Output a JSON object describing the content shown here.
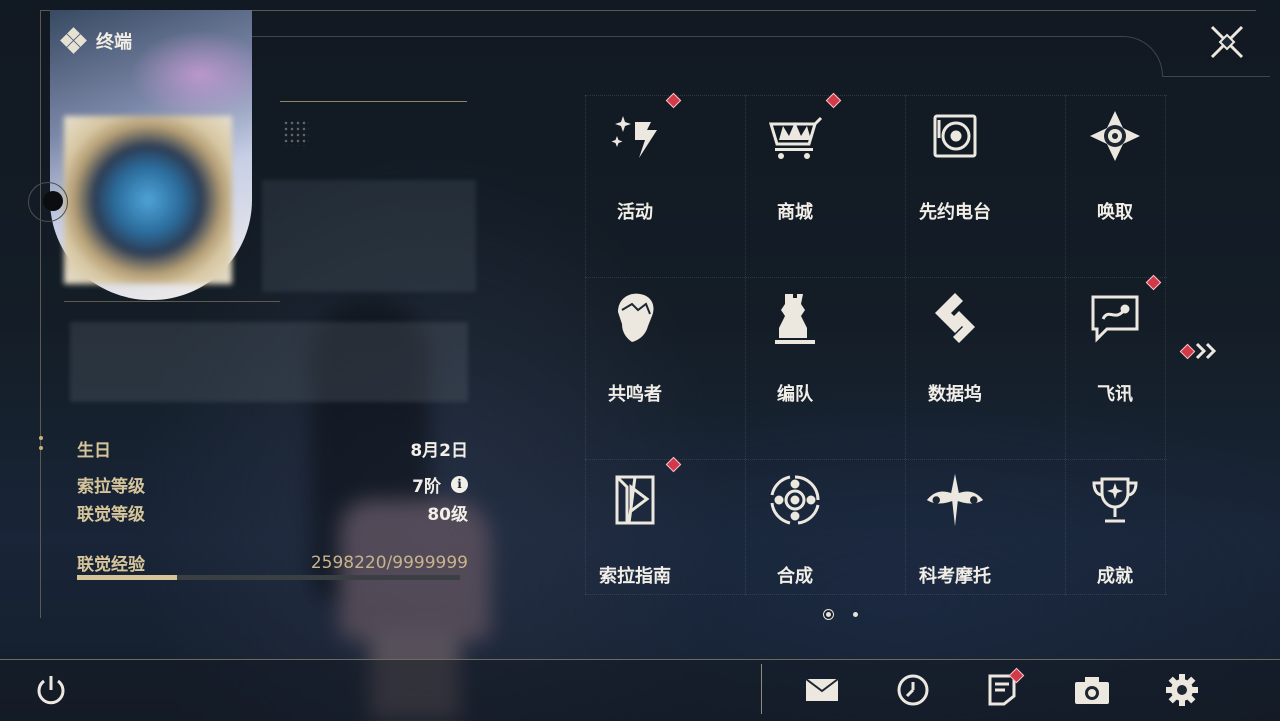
{
  "header": {
    "title": "终端",
    "logo_icon": "diamond-cluster-icon"
  },
  "profile": {
    "stats": [
      {
        "label": "生日",
        "value": "8月2日"
      },
      {
        "label": "索拉等级",
        "value": "7阶",
        "info_icon": "i"
      },
      {
        "label": "联觉等级",
        "value": "80级"
      }
    ],
    "experience": {
      "label": "联觉经验",
      "value": "2598220/9999999",
      "progress": 0.26
    }
  },
  "menu": {
    "items": [
      {
        "label": "活动",
        "icon": "sparkle-stars-icon",
        "badge": true
      },
      {
        "label": "商城",
        "icon": "crown-cart-icon",
        "badge": true
      },
      {
        "label": "先约电台",
        "icon": "turntable-icon",
        "badge": false
      },
      {
        "label": "唤取",
        "icon": "compass-star-icon",
        "badge": false
      },
      {
        "label": "共鸣者",
        "icon": "character-head-icon",
        "badge": false
      },
      {
        "label": "编队",
        "icon": "chess-pieces-icon",
        "badge": false
      },
      {
        "label": "数据坞",
        "icon": "data-dock-icon",
        "badge": false
      },
      {
        "label": "飞讯",
        "icon": "message-bubble-icon",
        "badge": true
      },
      {
        "label": "索拉指南",
        "icon": "guidebook-icon",
        "badge": true
      },
      {
        "label": "合成",
        "icon": "synthesis-orbit-icon",
        "badge": false
      },
      {
        "label": "科考摩托",
        "icon": "motorcycle-icon",
        "badge": false
      },
      {
        "label": "成就",
        "icon": "trophy-icon",
        "badge": false
      }
    ],
    "pagination": {
      "current": 1,
      "total": 2
    }
  },
  "bottom_bar": {
    "icons": [
      {
        "name": "mail-icon",
        "badge": false
      },
      {
        "name": "clock-icon",
        "badge": false
      },
      {
        "name": "notice-icon",
        "badge": true
      },
      {
        "name": "camera-icon",
        "badge": false
      },
      {
        "name": "settings-icon",
        "badge": false
      }
    ]
  },
  "colors": {
    "accent_gold": "#d5c49a",
    "badge_red": "#d23a4a",
    "text_light": "#f1eee7"
  }
}
